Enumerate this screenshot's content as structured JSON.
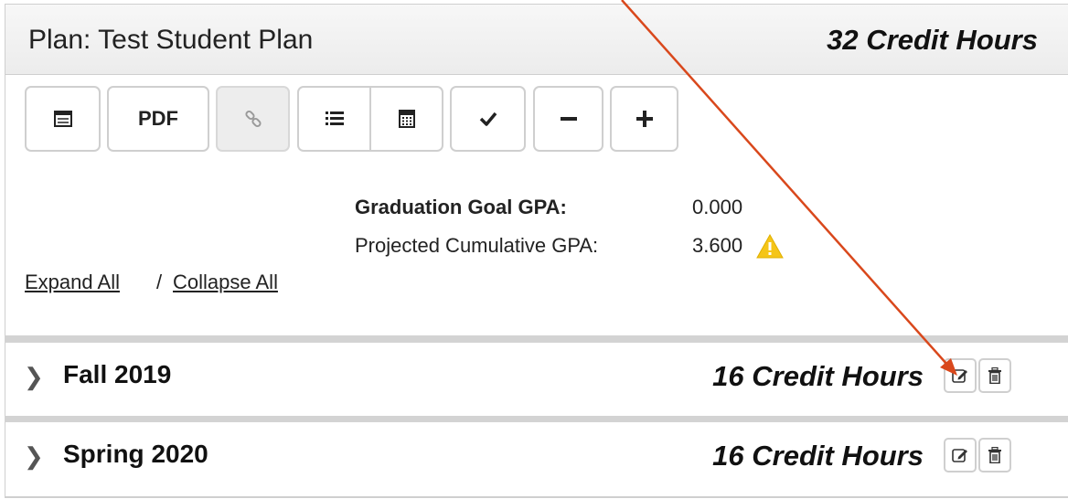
{
  "plan": {
    "title": "Plan: Test Student Plan",
    "credits": "32 Credit Hours"
  },
  "toolbar": {
    "pdf_label": "PDF",
    "buttons": [
      {
        "name": "details-view",
        "icon": "list-card-icon"
      },
      {
        "name": "pdf",
        "label": "PDF"
      },
      {
        "name": "link",
        "icon": "link-icon",
        "disabled": true
      },
      {
        "name": "list-view",
        "icon": "list-icon"
      },
      {
        "name": "calculator",
        "icon": "calculator-icon"
      },
      {
        "name": "check",
        "icon": "check-icon"
      },
      {
        "name": "collapse",
        "icon": "minus-icon"
      },
      {
        "name": "expand",
        "icon": "plus-icon"
      }
    ]
  },
  "gpa": {
    "goal_label": "Graduation Goal GPA:",
    "goal_value": "0.000",
    "projected_label": "Projected Cumulative GPA:",
    "projected_value": "3.600",
    "warning_icon": "warning-icon"
  },
  "links": {
    "expand_all": "Expand All",
    "separator": "/",
    "collapse_all": "Collapse All"
  },
  "terms": [
    {
      "name": "Fall 2019",
      "credits": "16 Credit Hours"
    },
    {
      "name": "Spring 2020",
      "credits": "16 Credit Hours"
    }
  ],
  "colors": {
    "annotation_arrow": "#d9481c",
    "warning": "#f5c518",
    "border": "#cfcfcf"
  }
}
